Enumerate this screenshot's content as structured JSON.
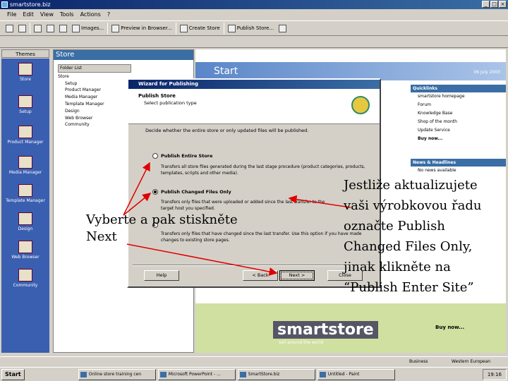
{
  "window": {
    "title": "smartstore.biz",
    "controls": [
      "_",
      "□",
      "×"
    ]
  },
  "menu": [
    "File",
    "Edit",
    "View",
    "Tools",
    "Actions",
    "?"
  ],
  "toolbar": {
    "buttons": [
      "Images...",
      "Preview in Browser...",
      "Create Store",
      "Publish Store..."
    ]
  },
  "themes": {
    "label": "Themes"
  },
  "nav": [
    "Store",
    "Setup",
    "Product Manager",
    "Media Manager",
    "Template Manager",
    "Design",
    "Web Browser",
    "Community"
  ],
  "store_panel": {
    "title": "Store",
    "folder_list_label": "Folder List",
    "tree": [
      "Store",
      "Setup",
      "Product Manager",
      "Media Manager",
      "Template Manager",
      "Design",
      "Web Browser",
      "Community"
    ]
  },
  "start_panel": {
    "title": "Start",
    "date": "06 July 2003",
    "quicklinks_title": "Quicklinks",
    "quicklinks": [
      "smartstore homepage",
      "Forum",
      "Knowledge Base",
      "Shop of the month",
      "Update Service",
      "Buy now..."
    ],
    "news_title": "News & Headlines",
    "news_text": "No news available",
    "banner_logo": "smartstore",
    "banner_tag": "sell around the world",
    "buy_now": "Buy now..."
  },
  "dialog": {
    "title": "Wizard for Publishing",
    "header": "Publish Store",
    "subheader": "Select publication type",
    "intro": "Decide whether the entire store or only updated files will be published.",
    "option1_label": "Publish Entire Store",
    "option1_desc": "Transfers all store files generated during the last stage procedure (product categories, products, templates, scripts and other media).",
    "option2_label": "Publish Changed Files Only",
    "option2_desc1": "Transfers only files that were uploaded or added since the last transfer to the",
    "option2_desc2": "target host you specified.",
    "option3_desc": "Transfers only files that have changed since the last transfer. Use this option if you have made changes to existing store pages.",
    "btn_help": "Help",
    "btn_back": "< Back",
    "btn_next": "Next >",
    "btn_close": "Close"
  },
  "statusbar": {
    "left": "Business",
    "right": "Western European"
  },
  "taskbar": {
    "start": "Start",
    "tasks": [
      "Online store training cen",
      "Microsoft PowerPoint - ...",
      "SmartStore.biz",
      "Untitled - Paint"
    ],
    "clock": "19:16"
  },
  "captions": {
    "left": "Vyberte a pak stiskněte Next",
    "right": "Jestliže aktualizujete vaši výrobkovou řadu označte Publish Changed Files Only, jinak klikněte na “Publish Enter Site”"
  },
  "colors": {
    "titlebar": "#0a246a",
    "nav_bg": "#3a5fb0",
    "arrow": "#e00000"
  }
}
